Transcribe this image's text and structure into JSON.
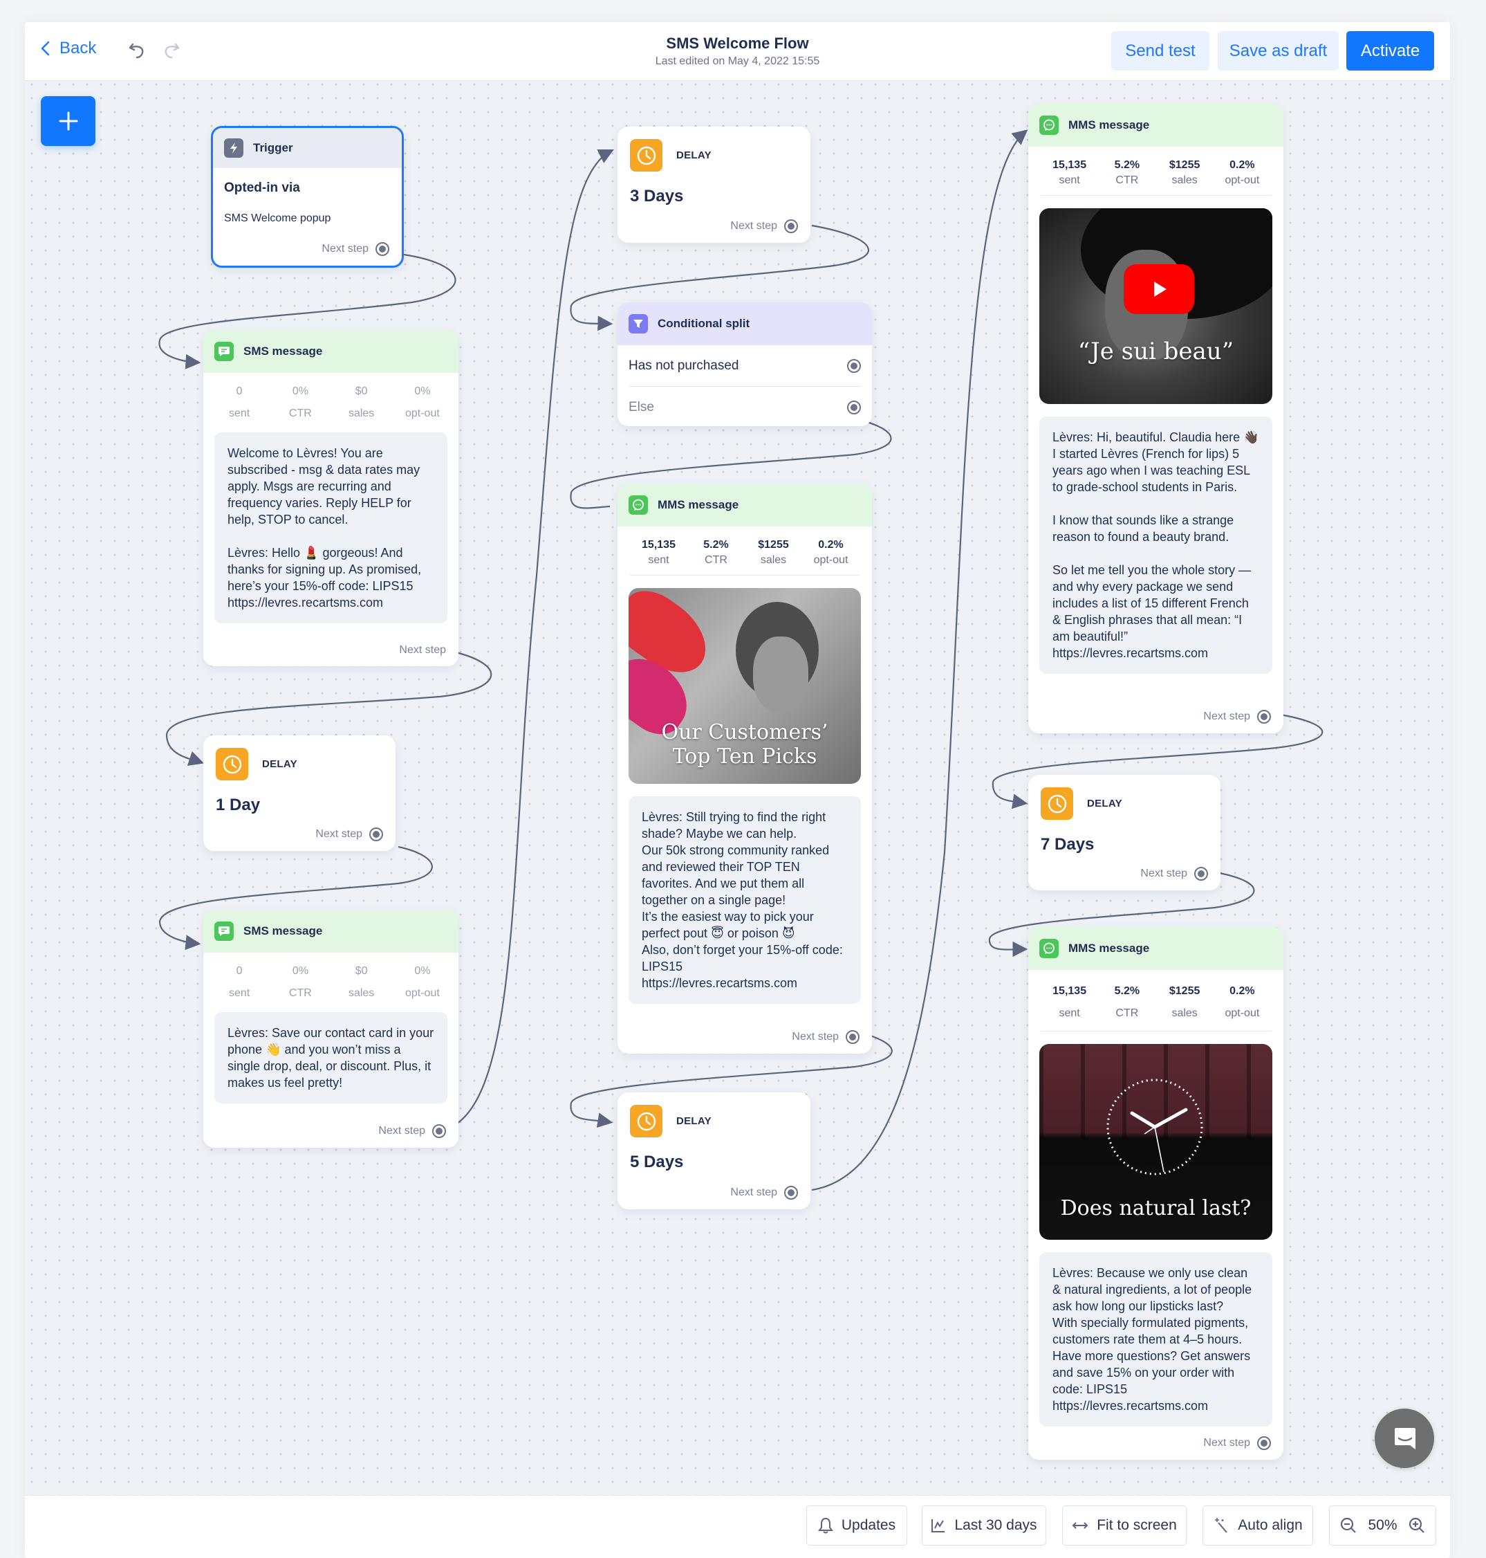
{
  "header": {
    "back_label": "Back",
    "title": "SMS Welcome Flow",
    "subtitle": "Last edited on May 4, 2022 15:55",
    "send_test": "Send test",
    "save_draft": "Save as draft",
    "activate": "Activate"
  },
  "colors": {
    "accent": "#1177ff",
    "delay": "#f6a623",
    "sms": "#4cc65a",
    "split": "#7b7cf5"
  },
  "common": {
    "next_step": "Next step",
    "stat_labels": [
      "sent",
      "CTR",
      "sales",
      "opt-out"
    ]
  },
  "trigger": {
    "header": "Trigger",
    "title": "Opted-in via",
    "subtitle": "SMS Welcome popup"
  },
  "sms1": {
    "header": "SMS message",
    "stats": [
      "0",
      "0%",
      "$0",
      "0%"
    ],
    "text": "Welcome to Lèvres! You are subscribed - msg & data rates may apply. Msgs are recurring and frequency varies. Reply HELP for help, STOP to cancel.\n\nLèvres: Hello 💄 gorgeous! And thanks for signing up. As promised, here’s your 15%-off code: LIPS15\nhttps://levres.recartsms.com"
  },
  "delay1": {
    "label": "DELAY",
    "value": "1 Day"
  },
  "sms2": {
    "header": "SMS message",
    "stats": [
      "0",
      "0%",
      "$0",
      "0%"
    ],
    "text": "Lèvres: Save our contact card in your phone 👋 and you won’t miss a single drop, deal, or discount. Plus, it makes us feel pretty!"
  },
  "delay3": {
    "label": "DELAY",
    "value": "3 Days"
  },
  "split": {
    "header": "Conditional split",
    "branches": [
      "Has not purchased",
      "Else"
    ]
  },
  "mms_mid": {
    "header": "MMS message",
    "stats": [
      "15,135",
      "5.2%",
      "$1255",
      "0.2%"
    ],
    "image_caption": "Our Customers’\nTop Ten Picks",
    "text": "Lèvres: Still trying to find the right shade? Maybe we can help.\nOur 50k strong community ranked and reviewed their TOP TEN favorites. And we put them all together on a single page!\nIt’s the easiest way to pick your perfect pout 😇 or poison 😈\nAlso, don’t forget your 15%-off code: LIPS15\nhttps://levres.recartsms.com"
  },
  "delay5": {
    "label": "DELAY",
    "value": "5 Days"
  },
  "mms_r1": {
    "header": "MMS message",
    "stats": [
      "15,135",
      "5.2%",
      "$1255",
      "0.2%"
    ],
    "image_caption": "“Je sui beau”",
    "text": "Lèvres: Hi, beautiful. Claudia here 👋🏿 I started Lèvres (French for lips) 5 years ago when I was teaching ESL to grade-school students in Paris.\n\nI know that sounds like a strange reason to found a beauty brand.\n\nSo let me tell you the whole story — and why every package we send includes a list of 15 different French & English phrases that all mean: “I am beautiful!”\nhttps://levres.recartsms.com"
  },
  "delay7": {
    "label": "DELAY",
    "value": "7 Days"
  },
  "mms_r2": {
    "header": "MMS message",
    "stats": [
      "15,135",
      "5.2%",
      "$1255",
      "0.2%"
    ],
    "image_caption": "Does natural last?",
    "text": "Lèvres: Because we only use clean & natural ingredients, a lot of people ask how long our lipsticks last?\nWith specially formulated pigments, customers rate them at 4–5 hours.\nHave more questions? Get answers and save 15% on your order with code: LIPS15\nhttps://levres.recartsms.com"
  },
  "bottombar": {
    "updates": "Updates",
    "range": "Last 30 days",
    "fit": "Fit to screen",
    "align": "Auto align",
    "zoom": "50%"
  }
}
